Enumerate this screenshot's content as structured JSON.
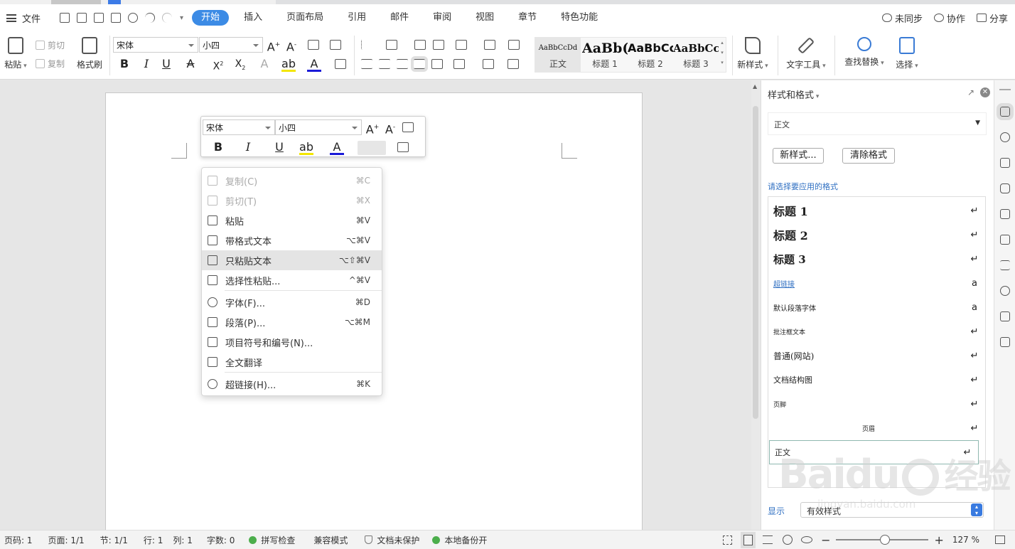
{
  "menubar": {
    "file": "文件",
    "tabs": [
      "开始",
      "插入",
      "页面布局",
      "引用",
      "邮件",
      "审阅",
      "视图",
      "章节",
      "特色功能"
    ],
    "active_tab": "开始",
    "sync": "未同步",
    "collab": "协作",
    "share": "分享"
  },
  "ribbon": {
    "paste": "粘贴",
    "cut": "剪切",
    "copy": "复制",
    "format_painter": "格式刷",
    "font": "宋体",
    "size": "小四",
    "styles": [
      {
        "preview": "AaBbCcDd",
        "label": "正文"
      },
      {
        "preview": "AaBb(",
        "label": "标题 1"
      },
      {
        "preview": "AaBbCc",
        "label": "标题 2"
      },
      {
        "preview": "AaBbCc",
        "label": "标题 3"
      }
    ],
    "new_style": "新样式",
    "text_tools": "文字工具",
    "find_replace": "查找替换",
    "select": "选择"
  },
  "mini_toolbar": {
    "font": "宋体",
    "size": "小四"
  },
  "context_menu": [
    {
      "label": "复制(C)",
      "shortcut": "⌘C",
      "disabled": true
    },
    {
      "label": "剪切(T)",
      "shortcut": "⌘X",
      "disabled": true
    },
    {
      "label": "粘贴",
      "shortcut": "⌘V"
    },
    {
      "label": "带格式文本",
      "shortcut": "⌥⌘V"
    },
    {
      "label": "只粘贴文本",
      "shortcut": "⌥⇧⌘V",
      "highlight": true
    },
    {
      "label": "选择性粘贴...",
      "shortcut": "^⌘V"
    },
    {
      "label": "字体(F)...",
      "shortcut": "⌘D"
    },
    {
      "label": "段落(P)...",
      "shortcut": "⌥⌘M"
    },
    {
      "label": "项目符号和编号(N)...",
      "shortcut": ""
    },
    {
      "label": "全文翻译",
      "shortcut": ""
    },
    {
      "label": "超链接(H)...",
      "shortcut": "⌘K"
    }
  ],
  "panel": {
    "title": "样式和格式",
    "current_style": "正文",
    "new_style_btn": "新样式...",
    "clear_btn": "清除格式",
    "hint": "请选择要应用的格式",
    "styles": [
      {
        "name": "标题  1",
        "mark": "↵"
      },
      {
        "name": "标题  2",
        "mark": "↵"
      },
      {
        "name": "标题  3",
        "mark": "↵"
      },
      {
        "name": "超链接",
        "mark": "a"
      },
      {
        "name": "默认段落字体",
        "mark": "a"
      },
      {
        "name": "批注框文本",
        "mark": "↵"
      },
      {
        "name": "普通(网站)",
        "mark": "↵"
      },
      {
        "name": "文档结构图",
        "mark": "↵"
      },
      {
        "name": "页脚",
        "mark": "↵"
      },
      {
        "name": "页眉",
        "mark": "↵"
      },
      {
        "name": "正文",
        "mark": "↵"
      }
    ],
    "show_label": "显示",
    "show_value": "有效样式"
  },
  "status": {
    "page_code": "页码: 1",
    "pages": "页面: 1/1",
    "section": "节: 1/1",
    "row": "行: 1",
    "col": "列: 1",
    "words": "字数: 0",
    "spell": "拼写检查",
    "compat": "兼容模式",
    "protect": "文档未保护",
    "backup": "本地备份开",
    "zoom": "127 %",
    "zoom_level": 0.53
  },
  "watermark": {
    "brand": "Bai",
    "brand2": "经验",
    "url": "jingyan.baidu.com"
  }
}
